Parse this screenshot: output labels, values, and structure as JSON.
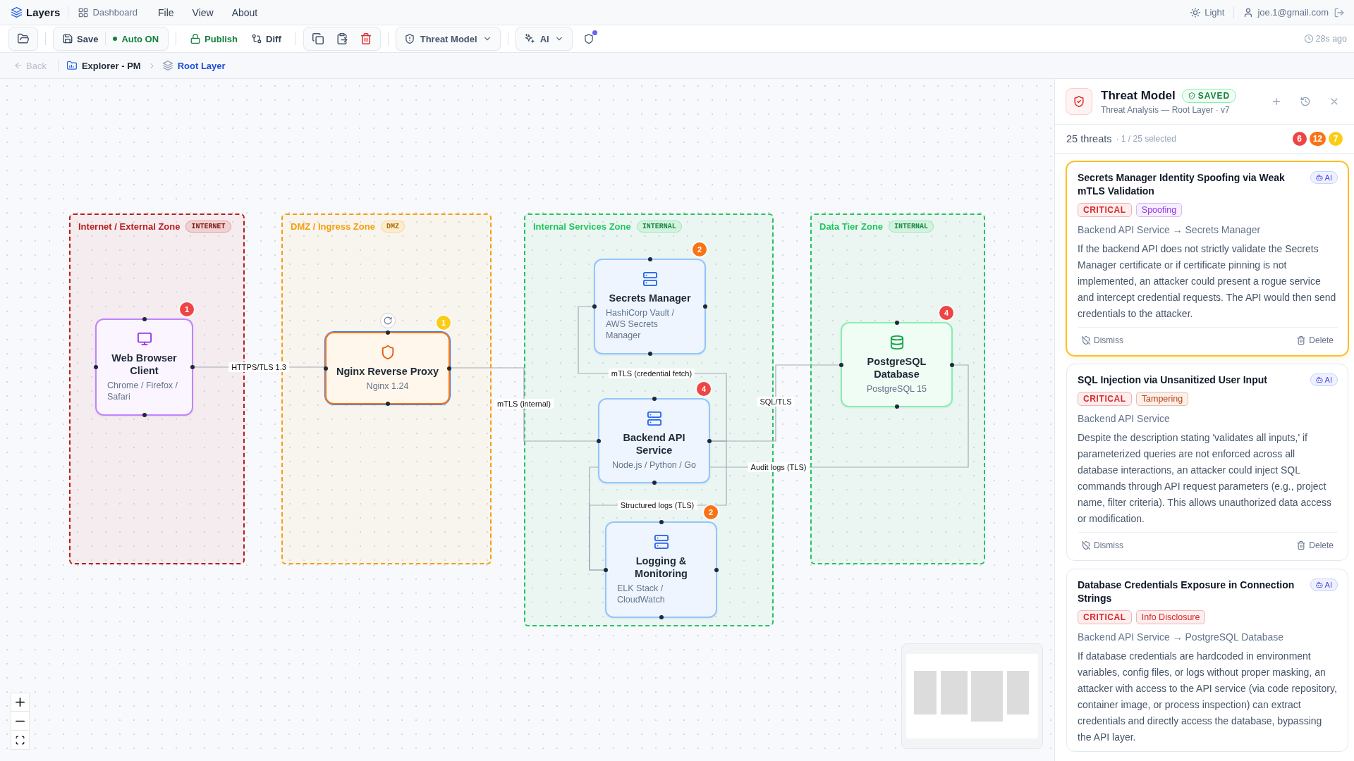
{
  "menu_bar": {
    "app_name": "Layers",
    "items": [
      {
        "label": "Dashboard",
        "kind": "link"
      },
      {
        "label": "File",
        "kind": "menu"
      },
      {
        "label": "View",
        "kind": "menu"
      },
      {
        "label": "About",
        "kind": "menu"
      }
    ],
    "theme_toggle": "Light",
    "user_email": "joe.1@gmail.com"
  },
  "toolbar": {
    "save": "Save",
    "autosave": {
      "label": "Auto ON",
      "on": true
    },
    "publish": "Publish",
    "diff": "Diff",
    "threat_model": "Threat Model",
    "ai": "AI",
    "alert": true,
    "last_saved": "28s ago"
  },
  "breadcrumb": {
    "back": {
      "label": "Back",
      "disabled": true
    },
    "items": [
      {
        "label": "Explorer - PM",
        "kind": "folder",
        "current": false
      },
      {
        "label": "Root Layer",
        "kind": "layer",
        "current": true
      }
    ]
  },
  "canvas": {
    "zones": [
      {
        "title": "Internet / External Zone",
        "tag": "INTERNET",
        "color": "#b91c1c"
      },
      {
        "title": "DMZ / Ingress Zone",
        "tag": "DMZ",
        "color": "#f59e0b"
      },
      {
        "title": "Internal Services Zone",
        "tag": "INTERNAL",
        "color": "#22c55e"
      },
      {
        "title": "Data Tier Zone",
        "tag": "INTERNAL",
        "color": "#22c55e"
      }
    ],
    "nodes": [
      {
        "title": "Web Browser Client",
        "subtitle": "Chrome / Firefox / Safari",
        "kind": "client",
        "selected": false,
        "threats": {
          "count": "1",
          "color": "#ef4444"
        }
      },
      {
        "title": "Nginx Reverse Proxy",
        "subtitle": "Nginx 1.24",
        "kind": "proxy",
        "selected": true,
        "threats": {
          "count": "1",
          "color": "#facc15"
        }
      },
      {
        "title": "Secrets Manager",
        "subtitle": "HashiCorp Vault / AWS Secrets Manager",
        "kind": "service",
        "selected": false,
        "threats": {
          "count": "2",
          "color": "#f97316"
        }
      },
      {
        "title": "Backend API Service",
        "subtitle": "Node.js / Python / Go",
        "kind": "service",
        "selected": false,
        "threats": {
          "count": "4",
          "color": "#ef4444"
        }
      },
      {
        "title": "Logging & Monitoring",
        "subtitle": "ELK Stack / CloudWatch",
        "kind": "service",
        "selected": false,
        "threats": {
          "count": "2",
          "color": "#f97316"
        }
      },
      {
        "title": "PostgreSQL Database",
        "subtitle": "PostgreSQL 15",
        "kind": "database",
        "selected": false,
        "threats": {
          "count": "4",
          "color": "#ef4444"
        }
      }
    ],
    "edges": [
      {
        "label": "HTTPS/TLS 1.3"
      },
      {
        "label": "mTLS (internal)"
      },
      {
        "label": "mTLS (credential fetch)"
      },
      {
        "label": "SQL/TLS"
      },
      {
        "label": "Audit logs (TLS)"
      },
      {
        "label": "Structured logs (TLS)"
      }
    ]
  },
  "threat_panel": {
    "title": "Threat Model",
    "status": "SAVED",
    "subtitle": "Threat Analysis — Root Layer · v7",
    "count": "25 threats",
    "selection": "· 1 / 25 selected",
    "severity_counts": [
      {
        "count": "6",
        "color": "#ef4444"
      },
      {
        "count": "12",
        "color": "#f97316"
      },
      {
        "count": "7",
        "color": "#facc15"
      }
    ],
    "threats": [
      {
        "title": "Secrets Manager Identity Spoofing via Weak mTLS Validation",
        "badge": "AI",
        "selected": true,
        "severity": {
          "label": "CRITICAL",
          "color": "#dc2626"
        },
        "category": {
          "label": "Spoofing",
          "color": "#9333ea"
        },
        "target": "Backend API Service → Secrets Manager",
        "description": "If the backend API does not strictly validate the Secrets Manager certificate or if certificate pinning is not implemented, an attacker could present a rogue service and intercept credential requests. The API would then send credentials to the attacker.",
        "actions": [
          {
            "label": "Dismiss",
            "kind": "dismiss"
          },
          {
            "label": "Delete",
            "kind": "delete"
          }
        ]
      },
      {
        "title": "SQL Injection via Unsanitized User Input",
        "badge": "AI",
        "selected": false,
        "severity": {
          "label": "CRITICAL",
          "color": "#dc2626"
        },
        "category": {
          "label": "Tampering",
          "color": "#c2410c"
        },
        "target": "Backend API Service",
        "description": "Despite the description stating 'validates all inputs,' if parameterized queries are not enforced across all database interactions, an attacker could inject SQL commands through API request parameters (e.g., project name, filter criteria). This allows unauthorized data access or modification.",
        "actions": [
          {
            "label": "Dismiss",
            "kind": "dismiss"
          },
          {
            "label": "Delete",
            "kind": "delete"
          }
        ]
      },
      {
        "title": "Database Credentials Exposure in Connection Strings",
        "badge": "AI",
        "selected": false,
        "severity": {
          "label": "CRITICAL",
          "color": "#dc2626"
        },
        "category": {
          "label": "Info Disclosure",
          "color": "#dc2626"
        },
        "target": "Backend API Service → PostgreSQL Database",
        "description": "If database credentials are hardcoded in environment variables, config files, or logs without proper masking, an attacker with access to the API service (via code repository, container image, or process inspection) can extract credentials and directly access the database, bypassing the API layer."
      }
    ]
  }
}
